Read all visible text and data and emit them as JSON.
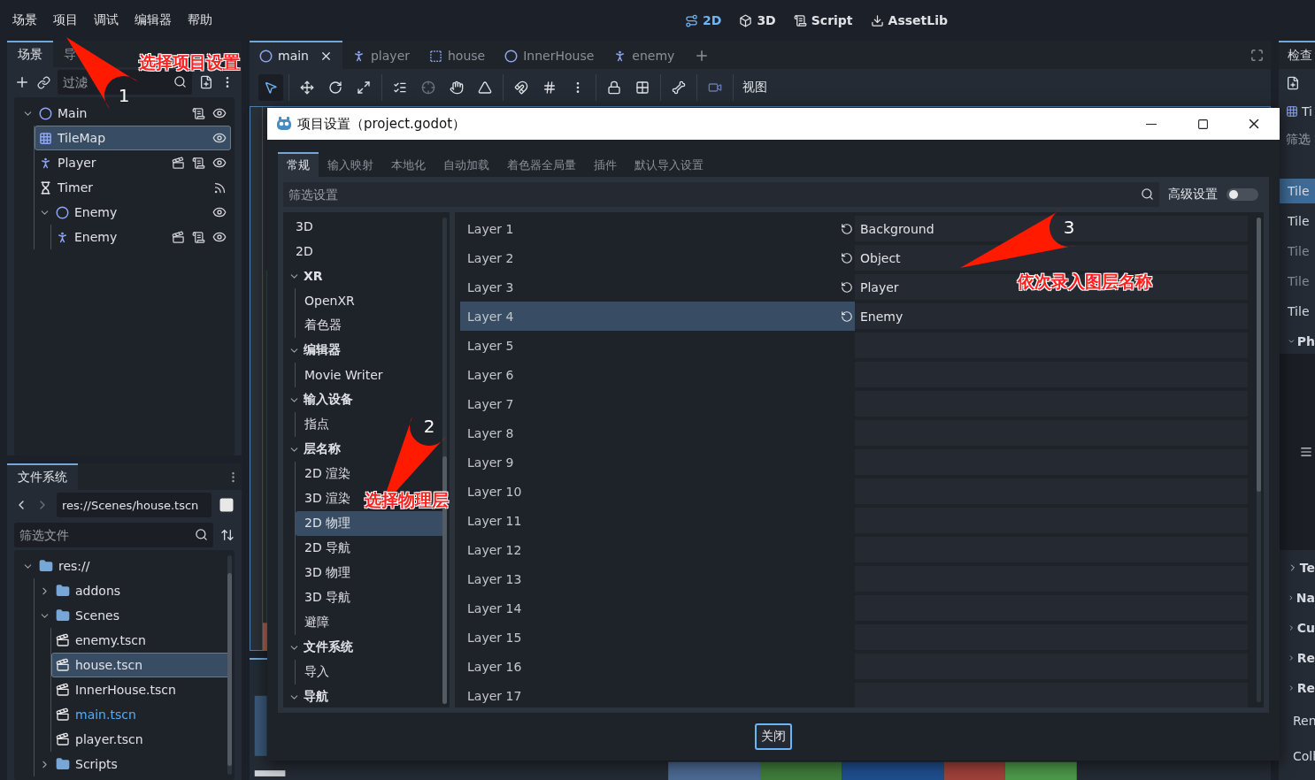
{
  "menu": [
    "场景",
    "项目",
    "调试",
    "编辑器",
    "帮助"
  ],
  "workspaces": [
    {
      "label": "2D",
      "kind": "flat",
      "selected": true
    },
    {
      "label": "3D",
      "kind": "spatial",
      "selected": false
    },
    {
      "label": "Script",
      "kind": "script",
      "selected": false
    },
    {
      "label": "AssetLib",
      "kind": "assetlib",
      "selected": false
    }
  ],
  "scene_dock": {
    "tabs": [
      {
        "label": "场景",
        "selected": true
      },
      {
        "label": "导",
        "selected": false
      }
    ],
    "filter": {
      "placeholder": "过滤"
    },
    "tree": [
      {
        "name": "Main",
        "kind": "node",
        "expanded": true,
        "selected": false,
        "script": true,
        "instance": false,
        "signals": false,
        "visible": true,
        "children": [
          {
            "name": "TileMap",
            "kind": "tilemap",
            "selected": true,
            "script": false,
            "instance": false,
            "signals": false,
            "visible": true
          },
          {
            "name": "Player",
            "kind": "character",
            "selected": false,
            "script": true,
            "instance": true,
            "signals": false,
            "visible": true
          },
          {
            "name": "Timer",
            "kind": "timer",
            "selected": false,
            "script": false,
            "instance": false,
            "signals": true
          },
          {
            "name": "Enemy",
            "kind": "node",
            "expanded": true,
            "selected": false,
            "script": false,
            "instance": false,
            "signals": false,
            "visible": true,
            "children": [
              {
                "name": "Enemy",
                "kind": "character",
                "selected": false,
                "script": true,
                "instance": true,
                "signals": false,
                "visible": true
              }
            ]
          }
        ]
      }
    ]
  },
  "filesystem": {
    "tab": "文件系统",
    "path": "res://Scenes/house.tscn",
    "filter": {
      "placeholder": "筛选文件"
    },
    "tree": [
      {
        "name": "res://",
        "kind": "folder",
        "expanded": true,
        "selected": false,
        "children": [
          {
            "name": "addons",
            "kind": "folder",
            "expanded": false,
            "selected": false
          },
          {
            "name": "Scenes",
            "kind": "folder",
            "expanded": true,
            "selected": false,
            "children": [
              {
                "name": "enemy.tscn",
                "kind": "scene",
                "selected": false,
                "current": false
              },
              {
                "name": "house.tscn",
                "kind": "scene",
                "selected": true,
                "current": false
              },
              {
                "name": "InnerHouse.tscn",
                "kind": "scene",
                "selected": false,
                "current": false
              },
              {
                "name": "main.tscn",
                "kind": "scene",
                "selected": false,
                "current": true
              },
              {
                "name": "player.tscn",
                "kind": "scene",
                "selected": false,
                "current": false
              }
            ]
          },
          {
            "name": "Scripts",
            "kind": "folder",
            "expanded": false,
            "selected": false
          }
        ]
      }
    ]
  },
  "editor_tabs": [
    {
      "label": "main",
      "kind": "node",
      "selected": true
    },
    {
      "label": "player",
      "kind": "character",
      "selected": false
    },
    {
      "label": "house",
      "kind": "frame",
      "selected": false
    },
    {
      "label": "InnerHouse",
      "kind": "node",
      "selected": false
    },
    {
      "label": "enemy",
      "kind": "character",
      "selected": false
    }
  ],
  "toolbar": {
    "tool_groups": [
      [
        {
          "kind": "select",
          "selected": true
        }
      ],
      [
        {
          "kind": "move",
          "selected": false
        },
        {
          "kind": "rotate",
          "selected": false
        },
        {
          "kind": "scale",
          "selected": false
        }
      ],
      [
        {
          "kind": "list",
          "selected": false
        },
        {
          "kind": "pivot",
          "selected": false
        },
        {
          "kind": "pan",
          "selected": false
        },
        {
          "kind": "ruler",
          "selected": false
        }
      ],
      [
        {
          "kind": "snap",
          "selected": false
        },
        {
          "kind": "grid",
          "selected": false
        },
        {
          "kind": "more",
          "selected": false
        }
      ],
      [
        {
          "kind": "lock",
          "selected": false
        },
        {
          "kind": "group",
          "selected": false
        }
      ],
      [
        {
          "kind": "bone",
          "selected": false
        }
      ],
      [
        {
          "kind": "camera",
          "selected": false
        }
      ]
    ],
    "view_menu": "视图"
  },
  "inspector": {
    "tab": "检查",
    "node": "Ti",
    "filter": "筛选",
    "rows": [
      {
        "label": "Tile",
        "kind": "header"
      },
      {
        "label": "Tile",
        "kind": "property",
        "disabled": false
      },
      {
        "label": "Tile",
        "kind": "property",
        "disabled": true
      },
      {
        "label": "Tile",
        "kind": "property",
        "disabled": true
      },
      {
        "label": "Tile",
        "kind": "property",
        "disabled": false
      },
      {
        "label": "Ph",
        "kind": "section"
      },
      {
        "kind": "panel"
      },
      {
        "label": "Te",
        "kind": "subsection"
      },
      {
        "label": "Na",
        "kind": "subsection"
      },
      {
        "label": "Cu",
        "kind": "subsection"
      },
      {
        "label": "Re",
        "kind": "subsection"
      },
      {
        "label": "Re",
        "kind": "subsection"
      },
      {
        "label": "Ren",
        "kind": "plain"
      },
      {
        "label": "Coll",
        "kind": "plain"
      }
    ]
  },
  "dialog": {
    "title": "项目设置（project.godot）",
    "tabs": [
      {
        "label": "常规",
        "selected": true
      },
      {
        "label": "输入映射",
        "selected": false
      },
      {
        "label": "本地化",
        "selected": false
      },
      {
        "label": "自动加载",
        "selected": false
      },
      {
        "label": "着色器全局量",
        "selected": false
      },
      {
        "label": "插件",
        "selected": false
      },
      {
        "label": "默认导入设置",
        "selected": false
      }
    ],
    "filter": {
      "placeholder": "筛选设置"
    },
    "advanced": {
      "label": "高级设置",
      "on": false
    },
    "sections": [
      {
        "label": "3D",
        "kind": "item",
        "selected": false
      },
      {
        "label": "2D",
        "kind": "item",
        "selected": false
      },
      {
        "label": "XR",
        "kind": "group",
        "children": [
          {
            "label": "OpenXR",
            "kind": "item",
            "selected": false
          },
          {
            "label": "着色器",
            "kind": "item",
            "selected": false
          }
        ]
      },
      {
        "label": "编辑器",
        "kind": "group",
        "children": [
          {
            "label": "Movie Writer",
            "kind": "item",
            "selected": false
          }
        ]
      },
      {
        "label": "输入设备",
        "kind": "group",
        "children": [
          {
            "label": "指点",
            "kind": "item",
            "selected": false
          }
        ]
      },
      {
        "label": "层名称",
        "kind": "group",
        "children": [
          {
            "label": "2D 渲染",
            "kind": "item",
            "selected": false
          },
          {
            "label": "3D 渲染",
            "kind": "item",
            "selected": false
          },
          {
            "label": "2D 物理",
            "kind": "item",
            "selected": true
          },
          {
            "label": "2D 导航",
            "kind": "item",
            "selected": false
          },
          {
            "label": "3D 物理",
            "kind": "item",
            "selected": false
          },
          {
            "label": "3D 导航",
            "kind": "item",
            "selected": false
          },
          {
            "label": "避障",
            "kind": "item",
            "selected": false
          }
        ]
      },
      {
        "label": "文件系统",
        "kind": "group",
        "children": [
          {
            "label": "导入",
            "kind": "item",
            "selected": false
          }
        ]
      },
      {
        "label": "导航",
        "kind": "group"
      }
    ],
    "layers": [
      {
        "label": "Layer 1",
        "value": "Background",
        "selected": false,
        "modified": true
      },
      {
        "label": "Layer 2",
        "value": "Object",
        "selected": false,
        "modified": true
      },
      {
        "label": "Layer 3",
        "value": "Player",
        "selected": false,
        "modified": true
      },
      {
        "label": "Layer 4",
        "value": "Enemy",
        "selected": true,
        "modified": true
      },
      {
        "label": "Layer 5",
        "selected": false,
        "modified": false
      },
      {
        "label": "Layer 6",
        "selected": false,
        "modified": false
      },
      {
        "label": "Layer 7",
        "selected": false,
        "modified": false
      },
      {
        "label": "Layer 8",
        "selected": false,
        "modified": false
      },
      {
        "label": "Layer 9",
        "selected": false,
        "modified": false
      },
      {
        "label": "Layer 10",
        "selected": false,
        "modified": false
      },
      {
        "label": "Layer 11",
        "selected": false,
        "modified": false
      },
      {
        "label": "Layer 12",
        "selected": false,
        "modified": false
      },
      {
        "label": "Layer 13",
        "selected": false,
        "modified": false
      },
      {
        "label": "Layer 14",
        "selected": false,
        "modified": false
      },
      {
        "label": "Layer 15",
        "selected": false,
        "modified": false
      },
      {
        "label": "Layer 16",
        "selected": false,
        "modified": false
      },
      {
        "label": "Layer 17",
        "selected": false,
        "modified": false
      }
    ],
    "close_button": "关闭"
  },
  "annotations": [
    {
      "number": "1",
      "text": "选择项目设置"
    },
    {
      "number": "2",
      "text": "选择物理层"
    },
    {
      "number": "3",
      "text": "依次录入图层名称"
    }
  ]
}
